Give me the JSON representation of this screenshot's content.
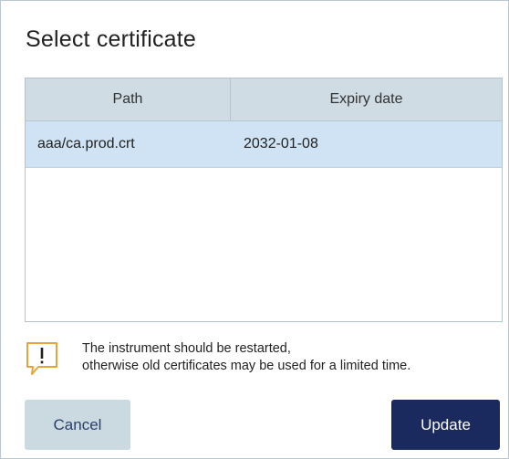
{
  "dialog": {
    "title": "Select certificate"
  },
  "table": {
    "columns": [
      "Path",
      "Expiry date"
    ],
    "rows": [
      {
        "path": "aaa/ca.prod.crt",
        "expiry": "2032-01-08",
        "selected": true
      }
    ]
  },
  "warning": {
    "icon": "warning-speech-bubble-icon",
    "line1": "The instrument should be restarted,",
    "line2": "otherwise old certificates may be used for a limited time."
  },
  "buttons": {
    "cancel_label": "Cancel",
    "update_label": "Update"
  },
  "colors": {
    "header_bg": "#cfdce3",
    "selected_row_bg": "#cfe3f4",
    "warning_accent": "#e8a33a",
    "cancel_bg": "#cbd9e1",
    "primary_bg": "#1b2a5e"
  }
}
